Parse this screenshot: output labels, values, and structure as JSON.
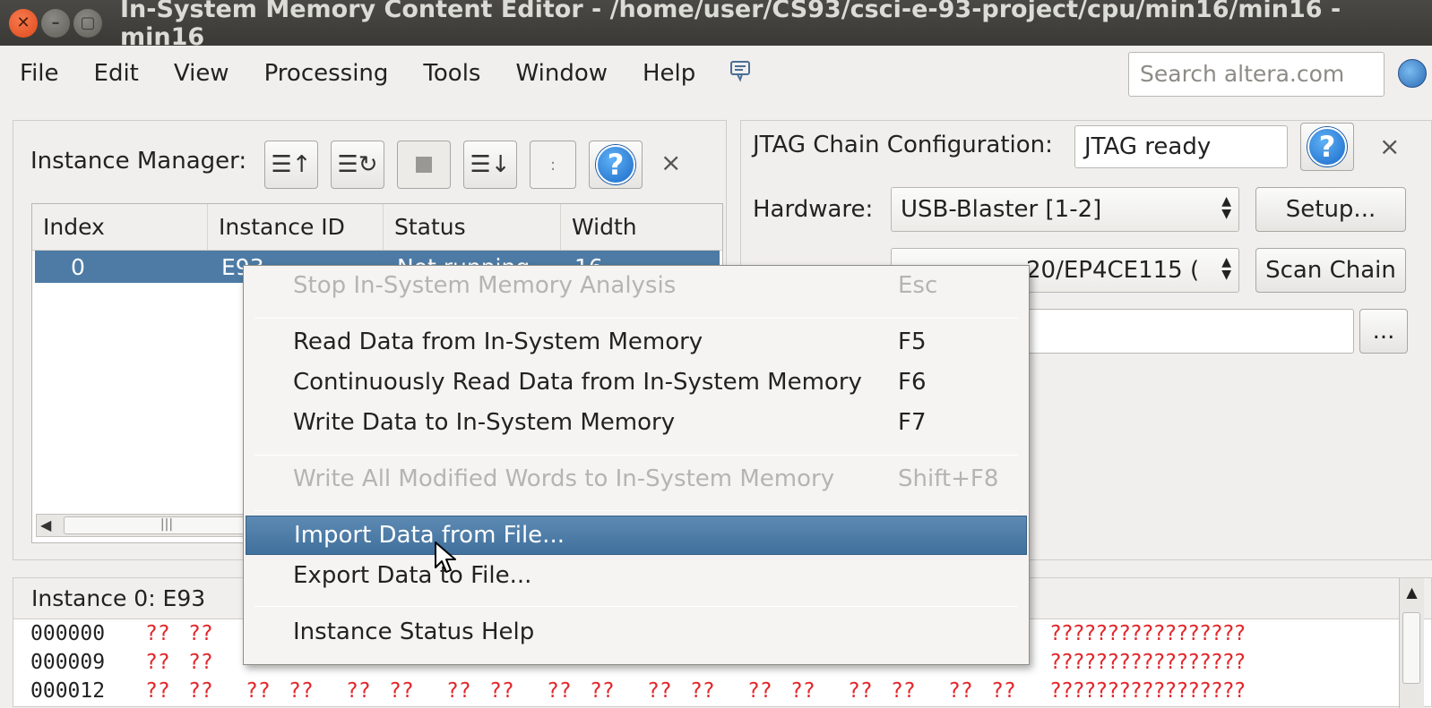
{
  "window": {
    "title": "In-System Memory Content Editor - /home/user/CS93/csci-e-93-project/cpu/min16/min16 - min16"
  },
  "menubar": {
    "items": [
      "File",
      "Edit",
      "View",
      "Processing",
      "Tools",
      "Window",
      "Help"
    ],
    "search_placeholder": "Search altera.com"
  },
  "instance_manager": {
    "label": "Instance Manager:",
    "columns": [
      "Index",
      "Instance ID",
      "Status",
      "Width"
    ],
    "row": {
      "index": "0",
      "instance_id": "E93",
      "status": "Not running",
      "width": "16"
    }
  },
  "jtag": {
    "label": "JTAG Chain Configuration:",
    "status": "JTAG ready",
    "hardware_label": "Hardware:",
    "hardware_value": "USB-Blaster [1-2]",
    "setup_button": "Setup...",
    "device_value": "20/EP4CE115 (",
    "scan_button": "Scan Chain",
    "browse_button": "..."
  },
  "memory": {
    "header": "Instance 0: E93",
    "rows": [
      {
        "addr": "000000",
        "ascii": "?????????????????"
      },
      {
        "addr": "000009",
        "ascii": "?????????????????"
      },
      {
        "addr": "000012",
        "ascii": "?????????????????"
      }
    ],
    "cell": "??"
  },
  "context_menu": {
    "items": [
      {
        "label": "Stop In-System Memory Analysis",
        "key": "Esc",
        "state": "disabled"
      },
      {
        "label": "Read Data from In-System Memory",
        "key": "F5",
        "state": "enabled"
      },
      {
        "label": "Continuously Read Data from In-System Memory",
        "key": "F6",
        "state": "enabled"
      },
      {
        "label": "Write Data to In-System Memory",
        "key": "F7",
        "state": "enabled"
      },
      {
        "label": "Write All Modified Words to In-System Memory",
        "key": "Shift+F8",
        "state": "disabled"
      },
      {
        "label": "Import Data from File...",
        "key": "",
        "state": "active"
      },
      {
        "label": "Export Data to File...",
        "key": "",
        "state": "enabled"
      },
      {
        "label": "Instance Status Help",
        "key": "",
        "state": "enabled"
      }
    ]
  }
}
